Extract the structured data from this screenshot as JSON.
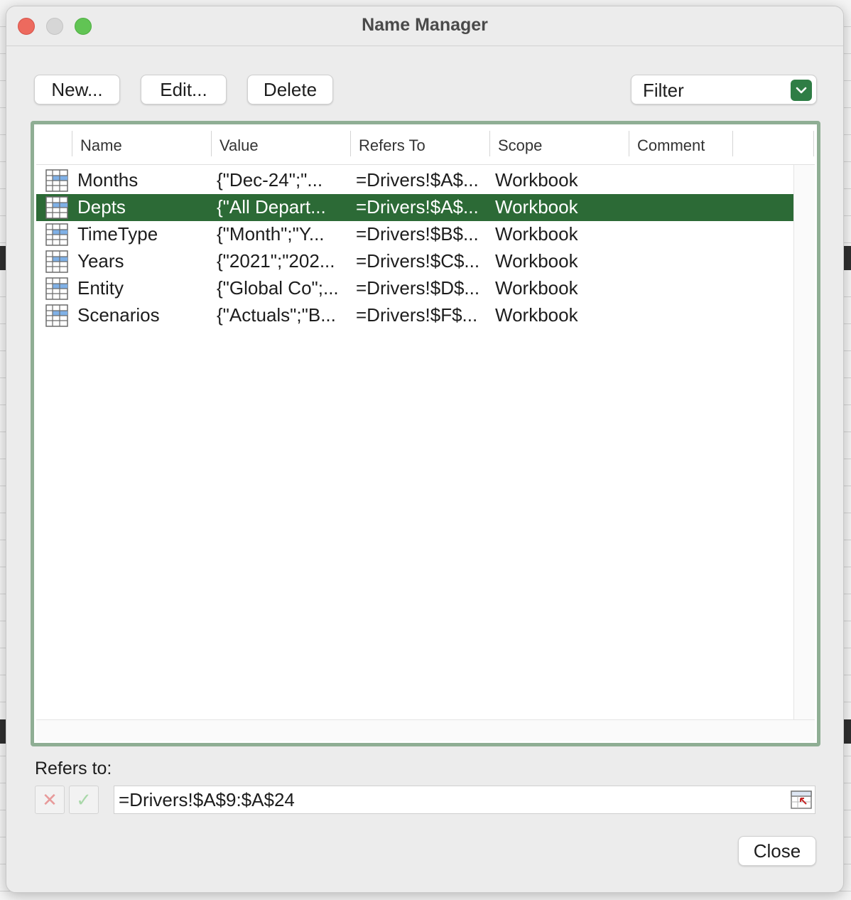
{
  "window": {
    "title": "Name Manager"
  },
  "toolbar": {
    "new_label": "New...",
    "edit_label": "Edit...",
    "delete_label": "Delete",
    "filter_label": "Filter",
    "filter_icon": "chevron-down-icon"
  },
  "table": {
    "columns": [
      "Name",
      "Value",
      "Refers To",
      "Scope",
      "Comment"
    ],
    "row_icon": "named-range-icon",
    "rows": [
      {
        "name": "Months",
        "value": "{\"Dec-24\";\"...",
        "refers_to": "=Drivers!$A$...",
        "scope": "Workbook",
        "comment": "",
        "selected": false
      },
      {
        "name": "Depts",
        "value": "{\"All Depart...",
        "refers_to": "=Drivers!$A$...",
        "scope": "Workbook",
        "comment": "",
        "selected": true
      },
      {
        "name": "TimeType",
        "value": "{\"Month\";\"Y...",
        "refers_to": "=Drivers!$B$...",
        "scope": "Workbook",
        "comment": "",
        "selected": false
      },
      {
        "name": "Years",
        "value": "{\"2021\";\"202...",
        "refers_to": "=Drivers!$C$...",
        "scope": "Workbook",
        "comment": "",
        "selected": false
      },
      {
        "name": "Entity",
        "value": "{\"Global Co\";...",
        "refers_to": "=Drivers!$D$...",
        "scope": "Workbook",
        "comment": "",
        "selected": false
      },
      {
        "name": "Scenarios",
        "value": "{\"Actuals\";\"B...",
        "refers_to": "=Drivers!$F$...",
        "scope": "Workbook",
        "comment": "",
        "selected": false
      }
    ]
  },
  "refers": {
    "label": "Refers to:",
    "value": "=Drivers!$A$9:$A$24",
    "cancel_icon": "x-icon",
    "confirm_icon": "checkmark-icon",
    "collapse_icon": "collapse-dialog-icon"
  },
  "footer": {
    "close_label": "Close"
  },
  "colors": {
    "selection": "#2c6a36",
    "list_border": "#8fae94",
    "filter_accent": "#2f7d45"
  }
}
